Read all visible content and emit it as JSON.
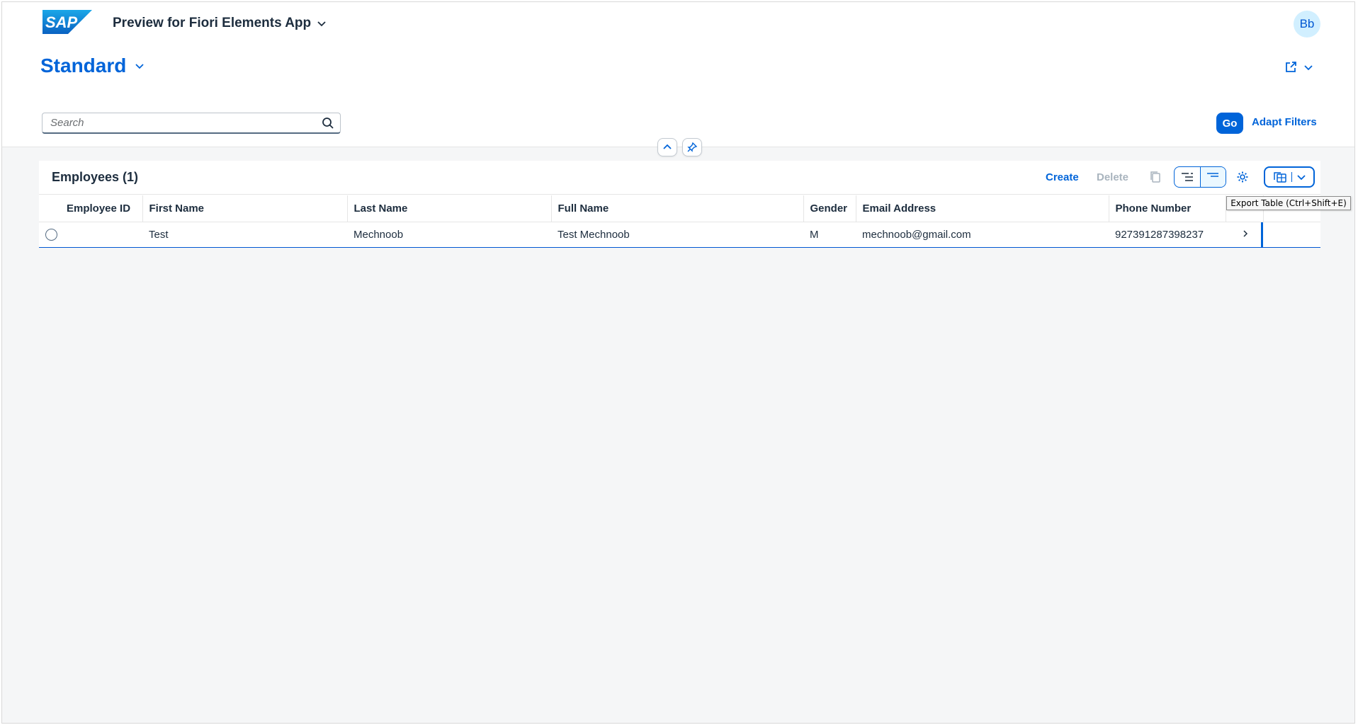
{
  "shell": {
    "logo_text": "SAP",
    "app_title": "Preview for Fiori Elements App",
    "avatar_initials": "Bb"
  },
  "header": {
    "variant_name": "Standard",
    "search_placeholder": "Search",
    "go_label": "Go",
    "adapt_filters_label": "Adapt Filters"
  },
  "table": {
    "title": "Employees (1)",
    "toolbar": {
      "create_label": "Create",
      "delete_label": "Delete"
    },
    "columns": [
      "Employee ID",
      "First Name",
      "Last Name",
      "Full Name",
      "Gender",
      "Email Address",
      "Phone Number"
    ],
    "rows": [
      {
        "employee_id": "",
        "first_name": "Test",
        "last_name": "Mechnoob",
        "full_name": "Test Mechnoob",
        "gender": "M",
        "email": "mechnoob@gmail.com",
        "phone": "927391287398237"
      }
    ]
  },
  "tooltip": {
    "text": "Export Table (Ctrl+Shift+E)"
  },
  "colors": {
    "accent": "#0064d9",
    "page_bg": "#f5f6f7",
    "text": "#1d2d3e",
    "disabled": "#a9b4be"
  }
}
